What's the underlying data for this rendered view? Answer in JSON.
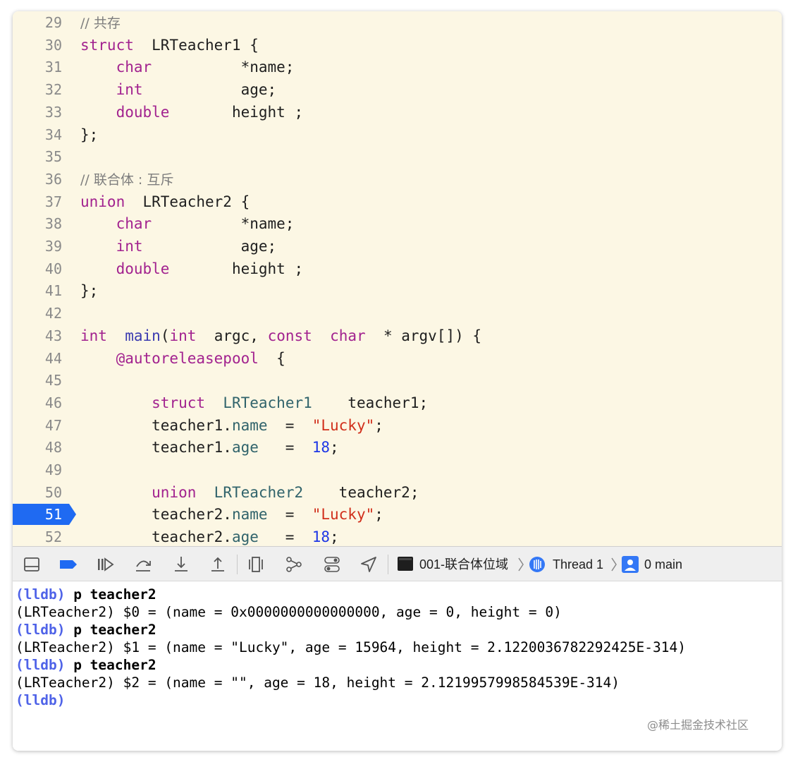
{
  "editor": {
    "lines": [
      {
        "n": "29",
        "segs": [
          [
            "c",
            "// 共存"
          ]
        ]
      },
      {
        "n": "30",
        "segs": [
          [
            "k",
            "struct"
          ],
          [
            "",
            "  LRTeacher1 {"
          ]
        ]
      },
      {
        "n": "31",
        "segs": [
          [
            "",
            "    "
          ],
          [
            "k",
            "char"
          ],
          [
            "",
            "          *name;"
          ]
        ]
      },
      {
        "n": "32",
        "segs": [
          [
            "",
            "    "
          ],
          [
            "k",
            "int"
          ],
          [
            "",
            "           age;"
          ]
        ]
      },
      {
        "n": "33",
        "segs": [
          [
            "",
            "    "
          ],
          [
            "k",
            "double"
          ],
          [
            "",
            "       height ;"
          ]
        ]
      },
      {
        "n": "34",
        "segs": [
          [
            "",
            "};"
          ]
        ]
      },
      {
        "n": "35",
        "segs": []
      },
      {
        "n": "36",
        "segs": [
          [
            "c",
            "// 联合体 : 互斥"
          ]
        ]
      },
      {
        "n": "37",
        "segs": [
          [
            "k",
            "union"
          ],
          [
            "",
            "  LRTeacher2 {"
          ]
        ]
      },
      {
        "n": "38",
        "segs": [
          [
            "",
            "    "
          ],
          [
            "k",
            "char"
          ],
          [
            "",
            "          *name;"
          ]
        ]
      },
      {
        "n": "39",
        "segs": [
          [
            "",
            "    "
          ],
          [
            "k",
            "int"
          ],
          [
            "",
            "           age;"
          ]
        ]
      },
      {
        "n": "40",
        "segs": [
          [
            "",
            "    "
          ],
          [
            "k",
            "double"
          ],
          [
            "",
            "       height ;"
          ]
        ]
      },
      {
        "n": "41",
        "segs": [
          [
            "",
            "};"
          ]
        ]
      },
      {
        "n": "42",
        "segs": []
      },
      {
        "n": "43",
        "segs": [
          [
            "k",
            "int"
          ],
          [
            "",
            "  "
          ],
          [
            "f",
            "main"
          ],
          [
            "",
            "("
          ],
          [
            "k",
            "int"
          ],
          [
            "",
            "  argc, "
          ],
          [
            "k",
            "const"
          ],
          [
            "",
            "  "
          ],
          [
            "k",
            "char"
          ],
          [
            "",
            "  * argv[]) {"
          ]
        ]
      },
      {
        "n": "44",
        "segs": [
          [
            "",
            "    "
          ],
          [
            "a",
            "@autoreleasepool"
          ],
          [
            "",
            "  {"
          ]
        ]
      },
      {
        "n": "45",
        "segs": []
      },
      {
        "n": "46",
        "segs": [
          [
            "",
            "        "
          ],
          [
            "k",
            "struct"
          ],
          [
            "",
            "  "
          ],
          [
            "t",
            "LRTeacher1"
          ],
          [
            "",
            "    teacher1;"
          ]
        ]
      },
      {
        "n": "47",
        "segs": [
          [
            "",
            "        teacher1."
          ],
          [
            "t",
            "name"
          ],
          [
            "",
            "  =  "
          ],
          [
            "s",
            "\"Lucky\""
          ],
          [
            "",
            ";"
          ]
        ]
      },
      {
        "n": "48",
        "segs": [
          [
            "",
            "        teacher1."
          ],
          [
            "t",
            "age"
          ],
          [
            "",
            "   =  "
          ],
          [
            "n",
            "18"
          ],
          [
            "",
            ";"
          ]
        ]
      },
      {
        "n": "49",
        "segs": []
      },
      {
        "n": "50",
        "segs": [
          [
            "",
            "        "
          ],
          [
            "k",
            "union"
          ],
          [
            "",
            "  "
          ],
          [
            "t",
            "LRTeacher2"
          ],
          [
            "",
            "    teacher2;"
          ]
        ]
      },
      {
        "n": "51",
        "segs": [
          [
            "",
            "        teacher2."
          ],
          [
            "t",
            "name"
          ],
          [
            "",
            "  =  "
          ],
          [
            "s",
            "\"Lucky\""
          ],
          [
            "",
            ";"
          ]
        ]
      },
      {
        "n": "52",
        "segs": [
          [
            "",
            "        teacher2."
          ],
          [
            "t",
            "age"
          ],
          [
            "",
            "   =  "
          ],
          [
            "n",
            "18"
          ],
          [
            "",
            ";"
          ]
        ]
      }
    ],
    "active_line": "51",
    "colors": {
      "breakpoint": "#1f6af2",
      "editor_bg": "#fcf7e4"
    }
  },
  "debug_bar": {
    "target": "001-联合体位域",
    "thread": "Thread 1",
    "frame": "0 main",
    "icons": [
      "hide-debug-area-icon",
      "breakpoints-toggle-icon",
      "continue-icon",
      "step-over-icon",
      "step-into-icon",
      "step-out-icon",
      "view-hierarchy-icon",
      "memory-graph-icon",
      "environment-overrides-icon",
      "simulate-location-icon"
    ]
  },
  "console": {
    "lines": [
      {
        "prompt": "(lldb)",
        "cmd": " p teacher2",
        "out": ""
      },
      {
        "prompt": "",
        "cmd": "",
        "out": "(LRTeacher2) $0 = (name = 0x0000000000000000, age = 0, height = 0)"
      },
      {
        "prompt": "(lldb)",
        "cmd": " p teacher2",
        "out": ""
      },
      {
        "prompt": "",
        "cmd": "",
        "out": "(LRTeacher2) $1 = (name = \"Lucky\", age = 15964, height = 2.1220036782292425E-314)"
      },
      {
        "prompt": "(lldb)",
        "cmd": " p teacher2",
        "out": ""
      },
      {
        "prompt": "",
        "cmd": "",
        "out": "(LRTeacher2) $2 = (name = \"\", age = 18, height = 2.1219957998584539E-314)"
      },
      {
        "prompt": "(lldb)",
        "cmd": "",
        "out": ""
      }
    ]
  },
  "watermark": "@稀土掘金技术社区"
}
